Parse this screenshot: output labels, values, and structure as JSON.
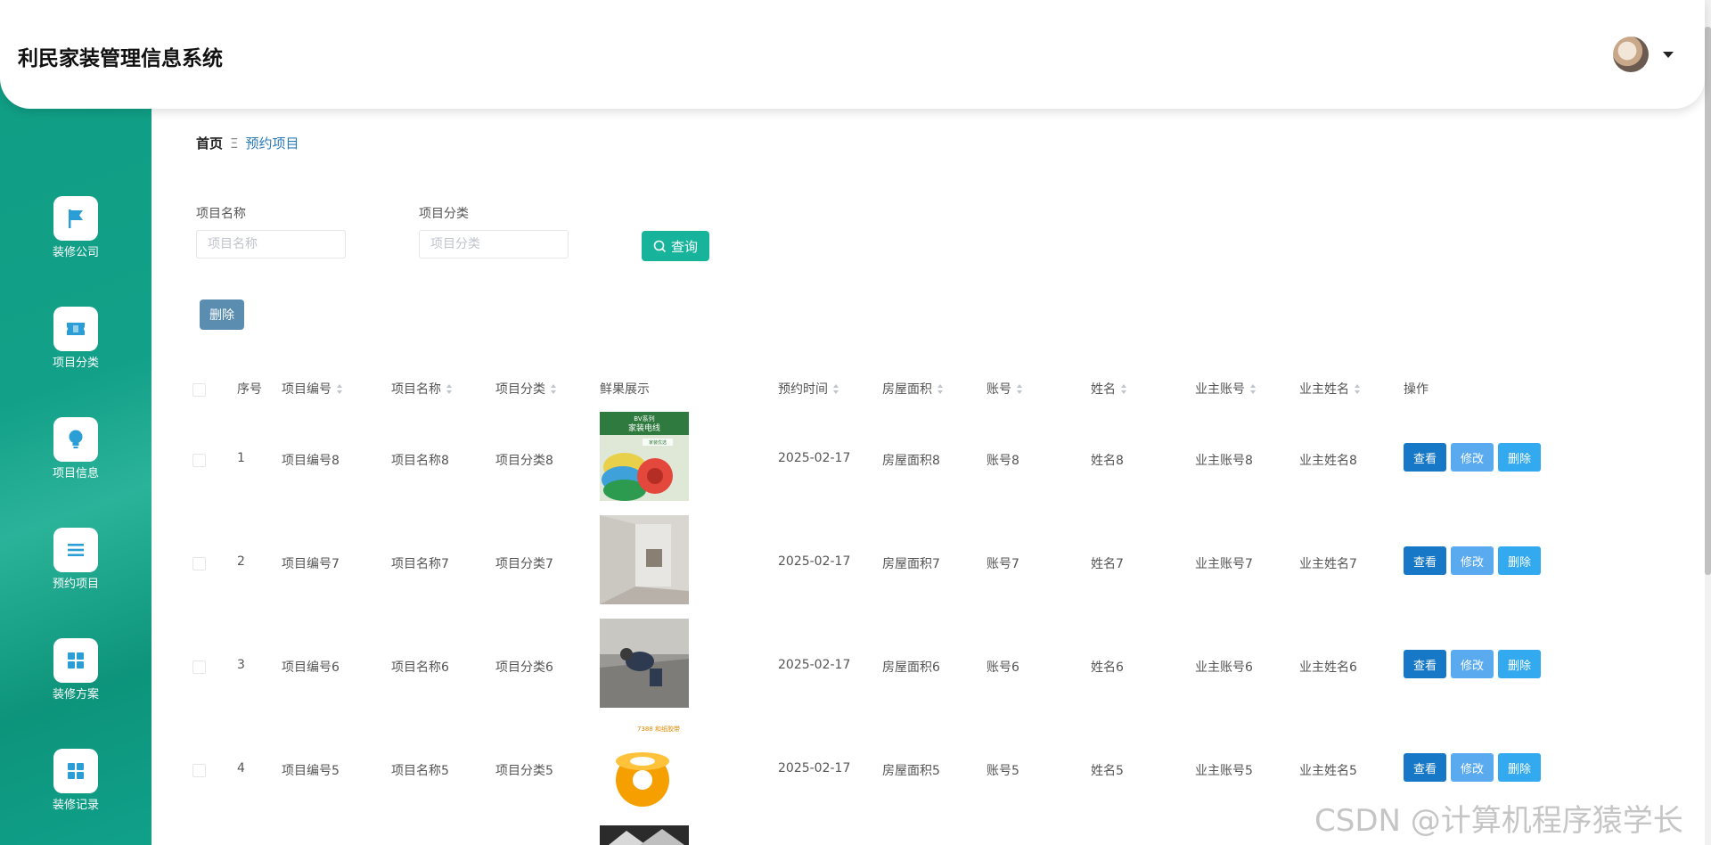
{
  "app": {
    "title": "利民家装管理信息系统"
  },
  "sidebar": {
    "items": [
      {
        "label": "装修公司",
        "icon": "flag-icon"
      },
      {
        "label": "项目分类",
        "icon": "ticket-icon"
      },
      {
        "label": "项目信息",
        "icon": "lightbulb-icon"
      },
      {
        "label": "预约项目",
        "icon": "list-icon"
      },
      {
        "label": "装修方案",
        "icon": "grid-icon"
      },
      {
        "label": "装修记录",
        "icon": "grid-icon"
      }
    ]
  },
  "breadcrumb": {
    "home": "首页",
    "separator": "Ξ",
    "current": "预约项目"
  },
  "search": {
    "name_label": "项目名称",
    "name_placeholder": "项目名称",
    "category_label": "项目分类",
    "category_placeholder": "项目分类",
    "button_label": "查询"
  },
  "bulk_delete_label": "删除",
  "table": {
    "headers": [
      "序号",
      "项目编号",
      "项目名称",
      "项目分类",
      "鲜果展示",
      "预约时间",
      "房屋面积",
      "账号",
      "姓名",
      "业主账号",
      "业主姓名",
      "操作"
    ],
    "rows": [
      {
        "index": "1",
        "code": "项目编号8",
        "name": "项目名称8",
        "category": "项目分类8",
        "time": "2025-02-17",
        "area": "房屋面积8",
        "account": "账号8",
        "person": "姓名8",
        "owner_account": "业主账号8",
        "owner_name": "业主姓名8"
      },
      {
        "index": "2",
        "code": "项目编号7",
        "name": "项目名称7",
        "category": "项目分类7",
        "time": "2025-02-17",
        "area": "房屋面积7",
        "account": "账号7",
        "person": "姓名7",
        "owner_account": "业主账号7",
        "owner_name": "业主姓名7"
      },
      {
        "index": "3",
        "code": "项目编号6",
        "name": "项目名称6",
        "category": "项目分类6",
        "time": "2025-02-17",
        "area": "房屋面积6",
        "account": "账号6",
        "person": "姓名6",
        "owner_account": "业主账号6",
        "owner_name": "业主姓名6"
      },
      {
        "index": "4",
        "code": "项目编号5",
        "name": "项目名称5",
        "category": "项目分类5",
        "time": "2025-02-17",
        "area": "房屋面积5",
        "account": "账号5",
        "person": "姓名5",
        "owner_account": "业主账号5",
        "owner_name": "业主姓名5"
      }
    ],
    "actions": {
      "view": "查看",
      "edit": "修改",
      "delete": "删除"
    }
  },
  "thumb_texts": {
    "brand": "BV系列",
    "product": "家装电线",
    "tag": "家装优选",
    "tape": "7388 和纸胶带"
  },
  "watermark": "CSDN @计算机程序猿学长",
  "colors": {
    "sidebar": "#12a088",
    "search_button": "#17b39b",
    "view_button": "#1778c8",
    "edit_button": "#5aaaf0",
    "delete_button": "#33a9f0",
    "bulk_delete": "#5b8db0"
  }
}
